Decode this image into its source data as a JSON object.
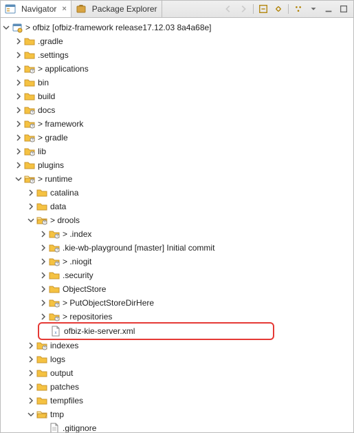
{
  "tabs": {
    "navigator": "Navigator",
    "package_explorer": "Package Explorer"
  },
  "root": {
    "label": "> ofbiz [ofbiz-framework release17.12.03 8a4a68e]"
  },
  "tree": {
    "gradle": ".gradle",
    "settings": ".settings",
    "applications": "> applications",
    "bin": "bin",
    "build": "build",
    "docs": "docs",
    "framework": "> framework",
    "gradle2": "> gradle",
    "lib": "lib",
    "plugins": "plugins",
    "runtime": "> runtime",
    "runtime_children": {
      "catalina": "catalina",
      "data": "data",
      "drools": "> drools",
      "drools_children": {
        "index": "> .index",
        "kie_wb": ".kie-wb-playground [master] Initial commit",
        "niogit": "> .niogit",
        "security": ".security",
        "objectstore": "ObjectStore",
        "putobj": "> PutObjectStoreDirHere",
        "repositories": "> repositories",
        "kie_server_xml": "ofbiz-kie-server.xml"
      },
      "indexes": "indexes",
      "logs": "logs",
      "output": "output",
      "patches": "patches",
      "tempfiles": "tempfiles",
      "tmp": "tmp",
      "tmp_children": {
        "gitignore": ".gitignore"
      }
    }
  }
}
